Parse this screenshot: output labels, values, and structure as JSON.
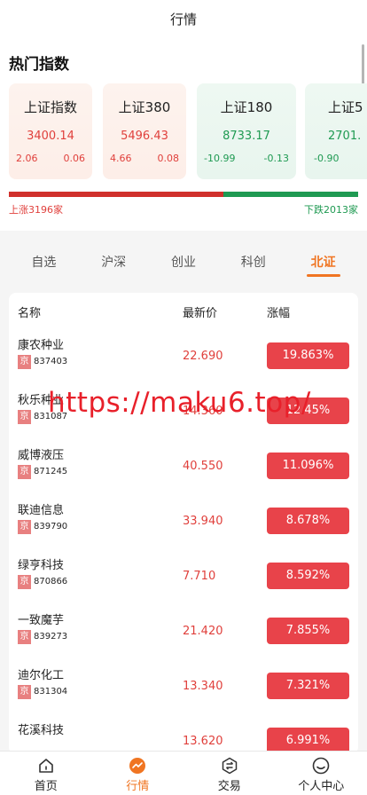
{
  "header": {
    "title": "行情"
  },
  "hot": {
    "title": "热门指数",
    "cards": [
      {
        "name": "上证指数",
        "price": "3400.14",
        "chg": "2.06",
        "pct": "0.06",
        "trend": "up"
      },
      {
        "name": "上证380",
        "price": "5496.43",
        "chg": "4.66",
        "pct": "0.08",
        "trend": "up"
      },
      {
        "name": "上证180",
        "price": "8733.17",
        "chg": "-10.99",
        "pct": "-0.13",
        "trend": "down"
      },
      {
        "name": "上证5",
        "price": "2701.",
        "chg": "-0.90",
        "pct": "",
        "trend": "down"
      }
    ],
    "rise_label": "上涨3196家",
    "fall_label": "下跌2013家",
    "rise_count": 3196,
    "fall_count": 2013
  },
  "tabs": [
    "自选",
    "沪深",
    "创业",
    "科创",
    "北证"
  ],
  "active_tab": 4,
  "list": {
    "headers": {
      "name": "名称",
      "price": "最新价",
      "change": "涨幅"
    },
    "market_tag": "京",
    "rows": [
      {
        "name": "康农种业",
        "code": "837403",
        "price": "22.690",
        "change": "19.863%"
      },
      {
        "name": "秋乐种业",
        "code": "831087",
        "price": "14.360",
        "change": "12.45%"
      },
      {
        "name": "威博液压",
        "code": "871245",
        "price": "40.550",
        "change": "11.096%"
      },
      {
        "name": "联迪信息",
        "code": "839790",
        "price": "33.940",
        "change": "8.678%"
      },
      {
        "name": "绿亨科技",
        "code": "870866",
        "price": "7.710",
        "change": "8.592%"
      },
      {
        "name": "一致魔芋",
        "code": "839273",
        "price": "21.420",
        "change": "7.855%"
      },
      {
        "name": "迪尔化工",
        "code": "831304",
        "price": "13.340",
        "change": "7.321%"
      },
      {
        "name": "花溪科技",
        "code": "",
        "price": "13.620",
        "change": "6.991%"
      }
    ]
  },
  "watermark": "https://maku6.top/",
  "nav": [
    {
      "label": "首页",
      "icon": "home-icon"
    },
    {
      "label": "行情",
      "icon": "chart-icon"
    },
    {
      "label": "交易",
      "icon": "exchange-icon"
    },
    {
      "label": "个人中心",
      "icon": "user-icon"
    }
  ],
  "active_nav": 1,
  "colors": {
    "accent": "#f07522",
    "rise": "#e0403c",
    "fall": "#1f9a52",
    "badge": "#e8434a"
  }
}
